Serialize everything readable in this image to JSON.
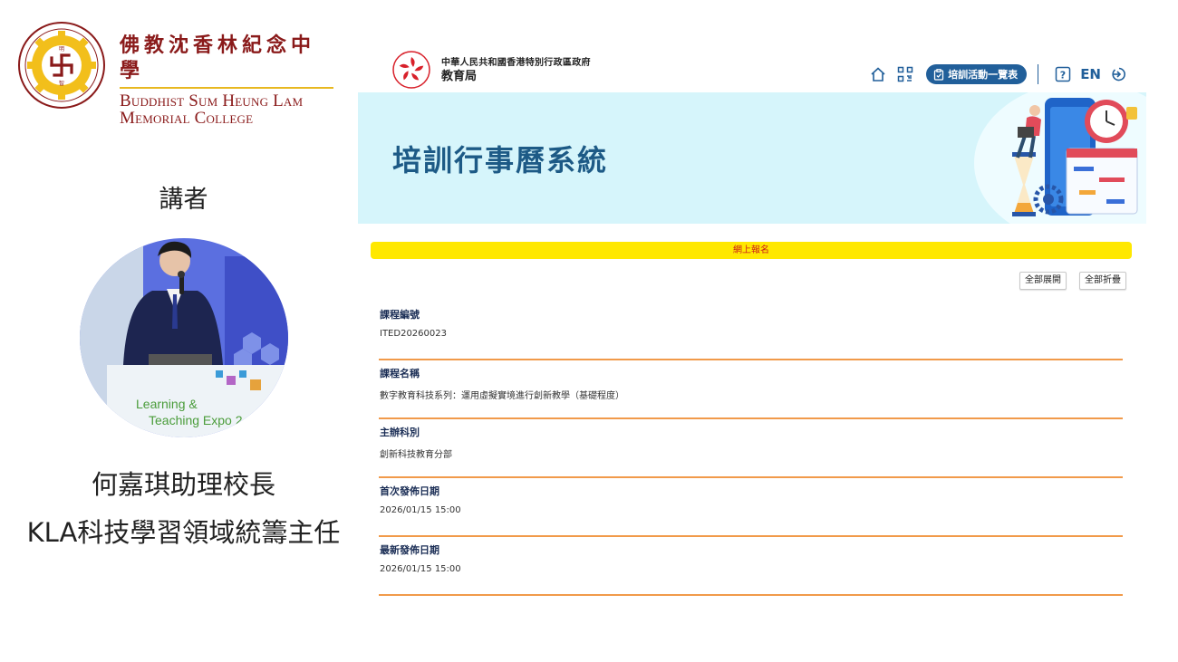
{
  "school": {
    "name_zh": "佛教沈香林紀念中學",
    "name_en_line1": "Buddhist Sum Heung Lam",
    "name_en_line2": "Memorial College",
    "logo_icon": "school-crest-icon",
    "brand_color": "#8a1a1a"
  },
  "speaker": {
    "label": "講者",
    "name": "何嘉琪助理校長",
    "title": "KLA科技學習領域統籌主任",
    "photo_expo_line1": "Learning &",
    "photo_expo_line2": "Teaching Expo 2"
  },
  "site": {
    "gov_line1": "中華人民共和國香港特別行政區政府",
    "gov_line2": "教育局",
    "nav": {
      "home_icon": "home-icon",
      "qr_icon": "qr-code-icon",
      "list_button": "培訓活動一覽表",
      "help_icon": "help-icon",
      "lang": "EN",
      "logout_icon": "logout-icon"
    },
    "banner_title": "培訓行事曆系統",
    "register_bar": "網上報名",
    "expand_all": "全部展開",
    "collapse_all": "全部折疊",
    "details": [
      {
        "label": "課程編號",
        "value": "ITED20260023"
      },
      {
        "label": "課程名稱",
        "value": "數字教育科技系列：運用虛擬實境進行創新教學（基礎程度）"
      },
      {
        "label": "主辦科別",
        "value": "創新科技教育分部"
      },
      {
        "label": "首次發佈日期",
        "value": "2026/01/15 15:00"
      },
      {
        "label": "最新發佈日期",
        "value": "2026/01/15 15:00"
      }
    ],
    "colors": {
      "primary": "#215f9a",
      "banner_bg": "#d6f5fb",
      "register_bar": "#ffe800",
      "divider": "#f19a4a"
    }
  }
}
